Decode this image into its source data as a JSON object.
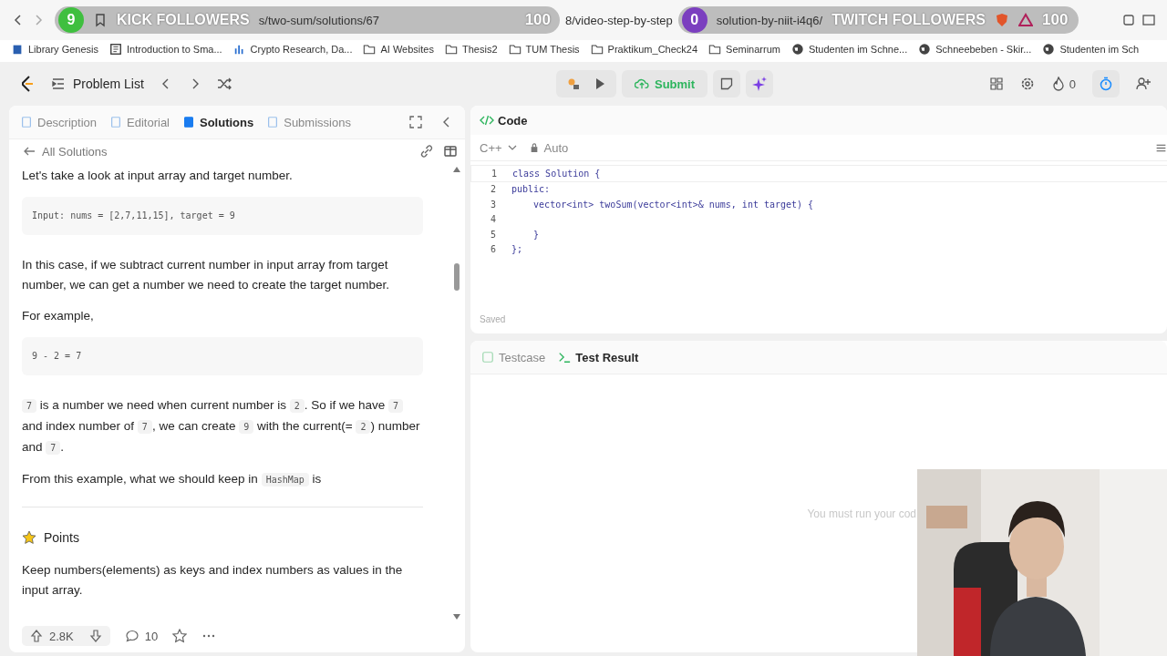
{
  "browser": {
    "overlays": [
      {
        "count": "9",
        "color": "#3fbf3f",
        "label": "KICK FOLLOWERS",
        "url_part": "s/two-sum/solutions/67",
        "total": "100"
      },
      {
        "count": "0",
        "color": "#7b3fbf",
        "label": "TWITCH FOLLOWERS",
        "url_part": "solution-by-niit-i4q6/",
        "total": "100"
      }
    ],
    "url_middle": "8/video-step-by-step",
    "bookmarks": [
      {
        "label": "Library Genesis",
        "kind": "book"
      },
      {
        "label": "Introduction to Sma...",
        "kind": "page"
      },
      {
        "label": "Crypto Research, Da...",
        "kind": "chart"
      },
      {
        "label": "AI Websites",
        "kind": "folder"
      },
      {
        "label": "Thesis2",
        "kind": "folder"
      },
      {
        "label": "TUM Thesis",
        "kind": "folder"
      },
      {
        "label": "Praktikum_Check24",
        "kind": "folder"
      },
      {
        "label": "Seminarrum",
        "kind": "folder"
      },
      {
        "label": "Studenten im Schne...",
        "kind": "globe"
      },
      {
        "label": "Schneebeben - Skir...",
        "kind": "globe"
      },
      {
        "label": "Studenten im Sch",
        "kind": "globe"
      }
    ]
  },
  "nav": {
    "problem_list": "Problem List",
    "submit": "Submit",
    "streak": "0"
  },
  "left": {
    "tabs": [
      {
        "label": "Description",
        "selected": false
      },
      {
        "label": "Editorial",
        "selected": false
      },
      {
        "label": "Solutions",
        "selected": true
      },
      {
        "label": "Submissions",
        "selected": false
      }
    ],
    "back": "All Solutions",
    "blocks": [
      {
        "kind": "text",
        "parts": [
          {
            "t": "Let's take a look at input array and target number."
          }
        ]
      },
      {
        "kind": "code",
        "text": "Input: nums = [2,7,11,15], target = 9"
      },
      {
        "kind": "text",
        "parts": [
          {
            "t": "In this case, if we subtract current number in input array from target number, we can get a number we need to create the target number."
          }
        ]
      },
      {
        "kind": "text",
        "parts": [
          {
            "t": "For example,"
          }
        ]
      },
      {
        "kind": "code",
        "text": "9 - 2 = 7"
      },
      {
        "kind": "text",
        "parts": [
          {
            "c": "7"
          },
          {
            "t": " is a number we need when current number is "
          },
          {
            "c": "2"
          },
          {
            "t": ". So if we have "
          },
          {
            "c": "7"
          },
          {
            "t": " and index number of "
          },
          {
            "c": "7"
          },
          {
            "t": ", we can create "
          },
          {
            "c": "9"
          },
          {
            "t": " with the current(= "
          },
          {
            "c": "2"
          },
          {
            "t": ") number and "
          },
          {
            "c": "7"
          },
          {
            "t": "."
          }
        ]
      },
      {
        "kind": "text",
        "parts": [
          {
            "t": "From this example, what we should keep in "
          },
          {
            "c": "HashMap"
          },
          {
            "t": " is"
          }
        ]
      },
      {
        "kind": "rule"
      },
      {
        "kind": "heading",
        "text": "Points"
      },
      {
        "kind": "text",
        "parts": [
          {
            "t": "Keep numbers(elements) as keys and index numbers as values in the input array."
          }
        ]
      }
    ],
    "votes": "2.8K",
    "comments": "10"
  },
  "editor": {
    "title": "Code",
    "language": "C++",
    "mode": "Auto",
    "lines": [
      {
        "no": "1",
        "text": "class Solution {"
      },
      {
        "no": "2",
        "text": "public:"
      },
      {
        "no": "3",
        "text": "    vector<int> twoSum(vector<int>& nums, int target) {"
      },
      {
        "no": "4"
      },
      {
        "no": "5",
        "text": "    }"
      },
      {
        "no": "6",
        "text": "};"
      }
    ],
    "status": "Saved"
  },
  "result": {
    "tabs": [
      {
        "label": "Testcase",
        "selected": false
      },
      {
        "label": "Test Result",
        "selected": true
      }
    ],
    "message": "You must run your cod"
  }
}
